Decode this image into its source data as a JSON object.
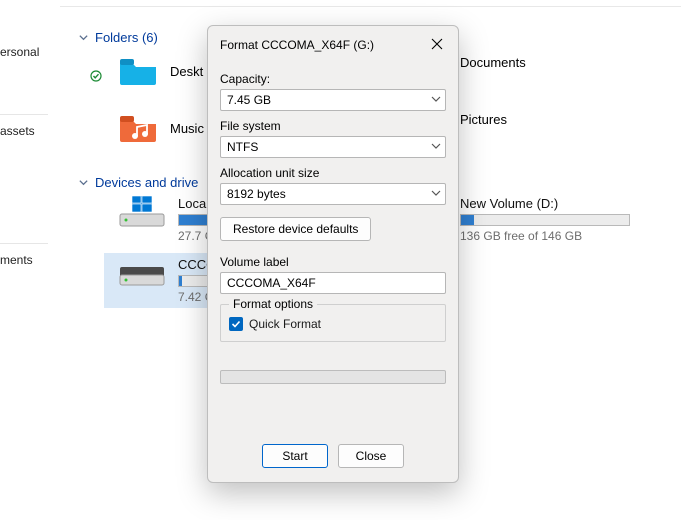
{
  "nav": {
    "items": [
      "ersonal",
      "assets",
      "ments"
    ]
  },
  "sections": {
    "folders_label": "Folders (6)",
    "devices_label": "Devices and drive"
  },
  "folders": {
    "desktop": "Deskt",
    "music": "Music",
    "documents": "Documents",
    "pictures": "Pictures"
  },
  "drives": {
    "local": {
      "name": "Local",
      "sub": "27.7 G",
      "fill_pct": 92
    },
    "newvol": {
      "name": "New Volume (D:)",
      "sub": "136 GB free of 146 GB",
      "fill_pct": 8
    },
    "ccc": {
      "name": "CCCO",
      "sub": "7.42 G",
      "fill_pct": 2
    }
  },
  "dialog": {
    "title": "Format CCCOMA_X64F (G:)",
    "capacity_label": "Capacity:",
    "capacity_value": "7.45 GB",
    "filesystem_label": "File system",
    "filesystem_value": "NTFS",
    "alloc_label": "Allocation unit size",
    "alloc_value": "8192 bytes",
    "restore_label": "Restore device defaults",
    "volume_label_label": "Volume label",
    "volume_label_value": "CCCOMA_X64F",
    "format_options_label": "Format options",
    "quick_format_label": "Quick Format",
    "start_label": "Start",
    "close_label": "Close"
  }
}
